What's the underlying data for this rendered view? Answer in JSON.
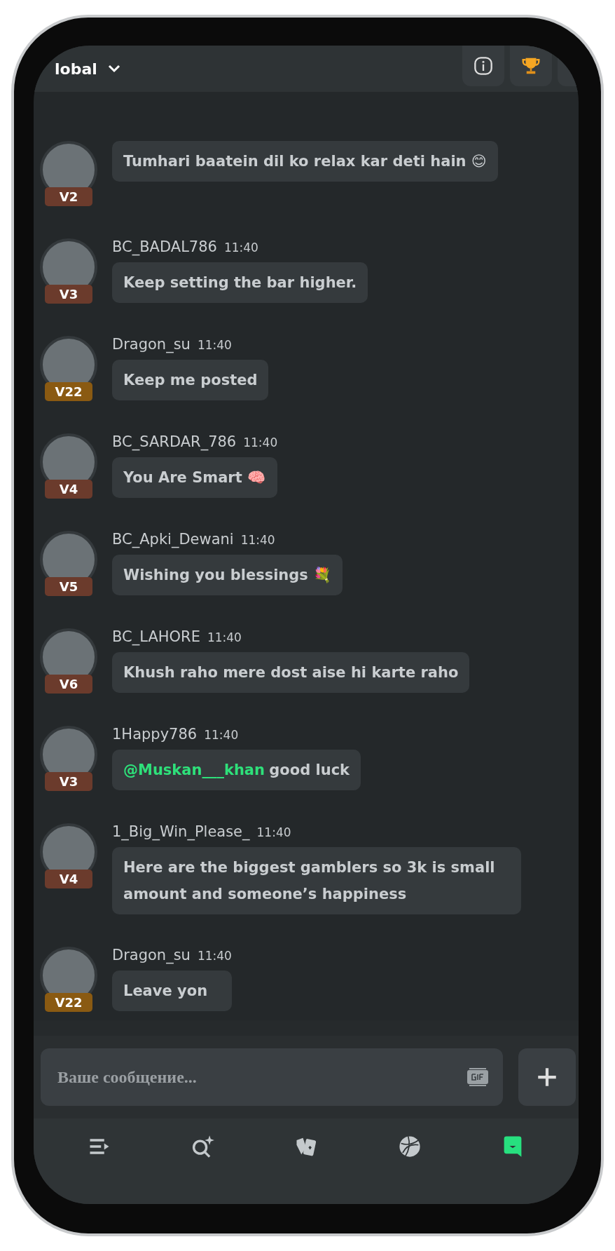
{
  "header": {
    "title": "lobal",
    "buttons": [
      {
        "kind": "info"
      },
      {
        "kind": "trophy"
      },
      {
        "kind": "cut"
      }
    ]
  },
  "messages": [
    {
      "badge": "V2",
      "color": "#6b3b2c",
      "text": "Tumhari baatein dil ko relax kar deti hain 😊"
    },
    {
      "user": "BC_BADAL786",
      "time": "11:40",
      "badge": "V3",
      "color": "#6b3b2c",
      "text": "Keep setting the bar higher."
    },
    {
      "user": "Dragon_su",
      "time": "11:40",
      "badge": "V22",
      "color": "#8a5a12",
      "text": "Keep me posted"
    },
    {
      "user": "BC_SARDAR_786",
      "time": "11:40",
      "badge": "V4",
      "color": "#6b3b2c",
      "text": "You Are Smart 🧠"
    },
    {
      "user": "BC_Apki_Dewani",
      "time": "11:40",
      "badge": "V5",
      "color": "#6b3b2c",
      "text": "Wishing you blessings 💐"
    },
    {
      "user": "BC_LAHORE",
      "time": "11:40",
      "badge": "V6",
      "color": "#6b3b2c",
      "text": "Khush raho mere dost aise hi karte raho"
    },
    {
      "user": "1Happy786",
      "time": "11:40",
      "badge": "V3",
      "color": "#6b3b2c",
      "mention": "@Muskan___khan",
      "text": "good luck"
    },
    {
      "user": "1_Big_Win_Please_",
      "time": "11:40",
      "badge": "V4",
      "color": "#6b3b2c",
      "text": "Here are the biggest gamblers so 3k is small amount and someone’s happiness"
    },
    {
      "user": "Dragon_su",
      "time": "11:40",
      "badge": "V22",
      "color": "#8a5a12",
      "text": "Leave yon"
    }
  ],
  "composer": {
    "placeholder": "Ваше сообщение..."
  },
  "nav": [
    {
      "kind": "menu",
      "selected": false
    },
    {
      "kind": "search",
      "selected": false
    },
    {
      "kind": "cards",
      "selected": false
    },
    {
      "kind": "ball",
      "selected": false
    },
    {
      "kind": "chat",
      "selected": true
    }
  ]
}
